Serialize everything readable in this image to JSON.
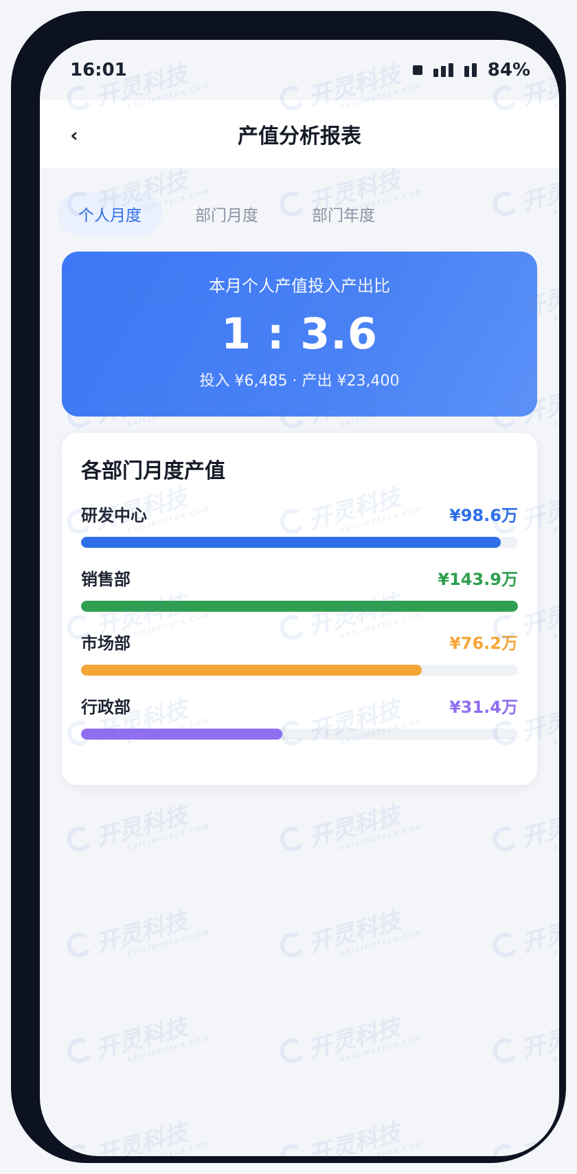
{
  "status_bar": {
    "time": "16:01",
    "battery": "84%"
  },
  "header": {
    "title": "产值分析报表",
    "back_glyph": "‹"
  },
  "tabs": [
    {
      "label": "个人月度",
      "active": true
    },
    {
      "label": "部门月度",
      "active": false
    },
    {
      "label": "部门年度",
      "active": false
    }
  ],
  "hero": {
    "label": "本月个人产值投入产出比",
    "ratio": "1 : 3.6",
    "sub": "投入 ¥6,485 · 产出 ¥23,400"
  },
  "departments": {
    "title": "各部门月度产值",
    "items": [
      {
        "name": "研发中心",
        "value": "¥98.6万",
        "fraction": 0.96,
        "color": "#2f6fea"
      },
      {
        "name": "销售部",
        "value": "¥143.9万",
        "fraction": 1.0,
        "color": "#2e9f4f"
      },
      {
        "name": "市场部",
        "value": "¥76.2万",
        "fraction": 0.78,
        "color": "#f5a638"
      },
      {
        "name": "行政部",
        "value": "¥31.4万",
        "fraction": 0.46,
        "color": "#8f6ef0"
      }
    ]
  },
  "watermark": {
    "cn": "开灵科技",
    "en": "KAILINGTECK.COM"
  }
}
